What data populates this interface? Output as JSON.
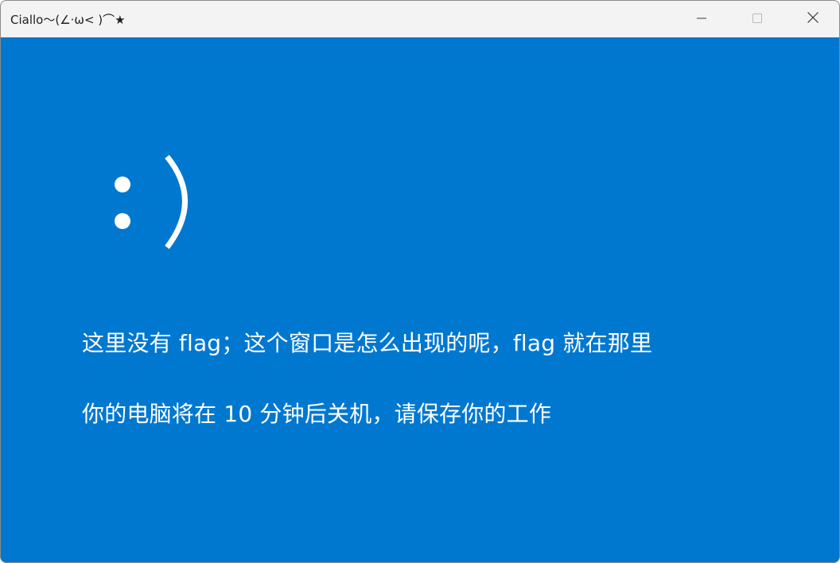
{
  "window": {
    "title": "Ciallo～(∠·ω< )⌒★"
  },
  "titlebar_buttons": {
    "minimize": "minimize-icon",
    "maximize": "maximize-icon",
    "close": "close-icon"
  },
  "face": {
    "emoticon": ":)"
  },
  "messages": {
    "line1": "这里没有 flag；这个窗口是怎么出现的呢，flag 就在那里",
    "line2": "你的电脑将在 10 分钟后关机，请保存你的工作"
  },
  "colors": {
    "background": "#0078d0",
    "text": "#ffffff",
    "titlebar": "#f3f3f3"
  }
}
